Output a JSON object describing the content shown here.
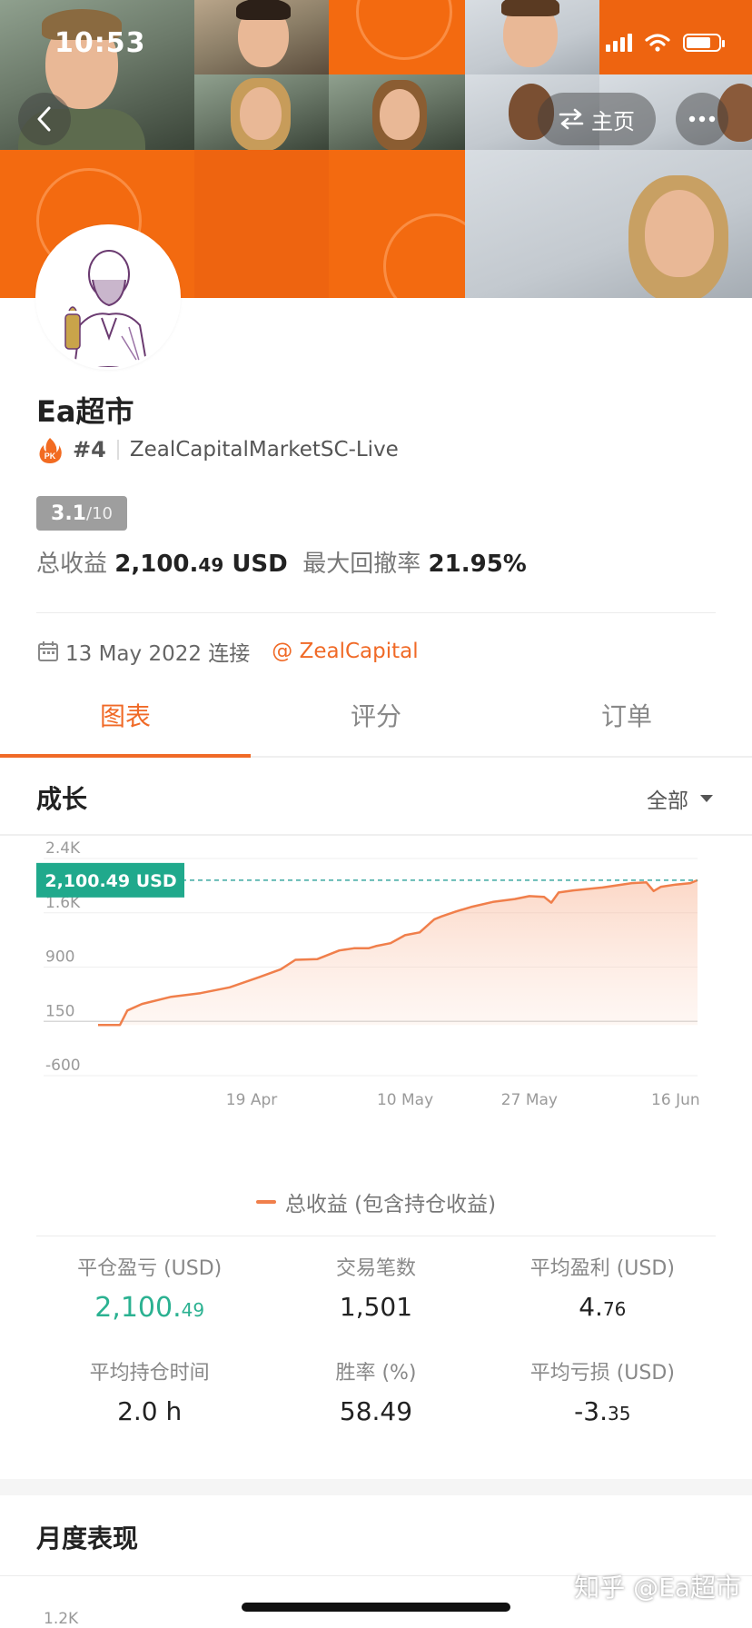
{
  "status_bar": {
    "time": "10:53"
  },
  "header": {
    "home_label": "主页"
  },
  "profile": {
    "name": "Ea超市",
    "rank": "#4",
    "account": "ZealCapitalMarketSC-Live",
    "score": "3.1",
    "score_denominator": "/10",
    "total_profit_label": "总收益",
    "total_profit_main": "2,100.",
    "total_profit_frac": "49",
    "total_profit_unit": "USD",
    "max_drawdown_label": "最大回撤率",
    "max_drawdown": "21.95%",
    "connected_date": "13 May 2022 连接",
    "broker_link": "@ ZealCapital"
  },
  "tabs": [
    {
      "label": "图表",
      "active": true
    },
    {
      "label": "评分",
      "active": false
    },
    {
      "label": "订单",
      "active": false
    }
  ],
  "growth": {
    "title": "成长",
    "filter": "全部"
  },
  "chart_data": {
    "type": "area",
    "y_tick_labels": [
      "2.4K",
      "1.6K",
      "900",
      "150",
      "-600"
    ],
    "y_ticks": [
      2400,
      1650,
      900,
      150,
      -600
    ],
    "x_tick_labels": [
      "19 Apr",
      "10 May",
      "27 May",
      "16 Jun"
    ],
    "x_ticks": [
      "2022-04-19",
      "2022-05-10",
      "2022-05-27",
      "2022-06-16"
    ],
    "ylim": [
      -600,
      2400
    ],
    "current_value_label": "2,100.49 USD",
    "current_value": 2100.49,
    "series": [
      {
        "name": "总收益 (包含持仓收益)",
        "x": [
          "2022-03-29",
          "2022-04-01",
          "2022-04-02",
          "2022-04-04",
          "2022-04-08",
          "2022-04-12",
          "2022-04-16",
          "2022-04-20",
          "2022-04-23",
          "2022-04-25",
          "2022-04-28",
          "2022-05-01",
          "2022-05-03",
          "2022-05-05",
          "2022-05-06",
          "2022-05-08",
          "2022-05-10",
          "2022-05-12",
          "2022-05-14",
          "2022-05-15",
          "2022-05-17",
          "2022-05-19",
          "2022-05-22",
          "2022-05-25",
          "2022-05-27",
          "2022-05-29",
          "2022-05-30",
          "2022-05-31",
          "2022-06-02",
          "2022-06-06",
          "2022-06-10",
          "2022-06-12",
          "2022-06-13",
          "2022-06-14",
          "2022-06-16",
          "2022-06-18",
          "2022-06-19"
        ],
        "values": [
          100,
          100,
          300,
          390,
          490,
          540,
          620,
          760,
          870,
          1000,
          1010,
          1130,
          1160,
          1160,
          1190,
          1230,
          1340,
          1380,
          1560,
          1600,
          1670,
          1730,
          1800,
          1840,
          1880,
          1870,
          1790,
          1930,
          1960,
          2000,
          2060,
          2070,
          1950,
          2010,
          2040,
          2060,
          2100.49
        ]
      }
    ],
    "legend_position": "bottom",
    "grid": true
  },
  "metrics": [
    {
      "label": "平仓盈亏 (USD)",
      "value": "2,100.",
      "frac": "49",
      "color": "#2bb191"
    },
    {
      "label": "交易笔数",
      "value": "1,501",
      "frac": ""
    },
    {
      "label": "平均盈利 (USD)",
      "value": "4.",
      "frac": "76"
    },
    {
      "label": "平均持仓时间",
      "value": "2.0 h",
      "frac": ""
    },
    {
      "label": "胜率 (%)",
      "value": "58.49",
      "frac": ""
    },
    {
      "label": "平均亏损 (USD)",
      "value": "-3.",
      "frac": "35"
    }
  ],
  "monthly": {
    "title": "月度表现",
    "first_tick": "1.2K"
  },
  "watermark": "知乎 @Ea超市",
  "colors": {
    "accent": "#f06a27",
    "green": "#2bb191",
    "line": "#f07f4b",
    "banner_orange": "#f36a10"
  }
}
